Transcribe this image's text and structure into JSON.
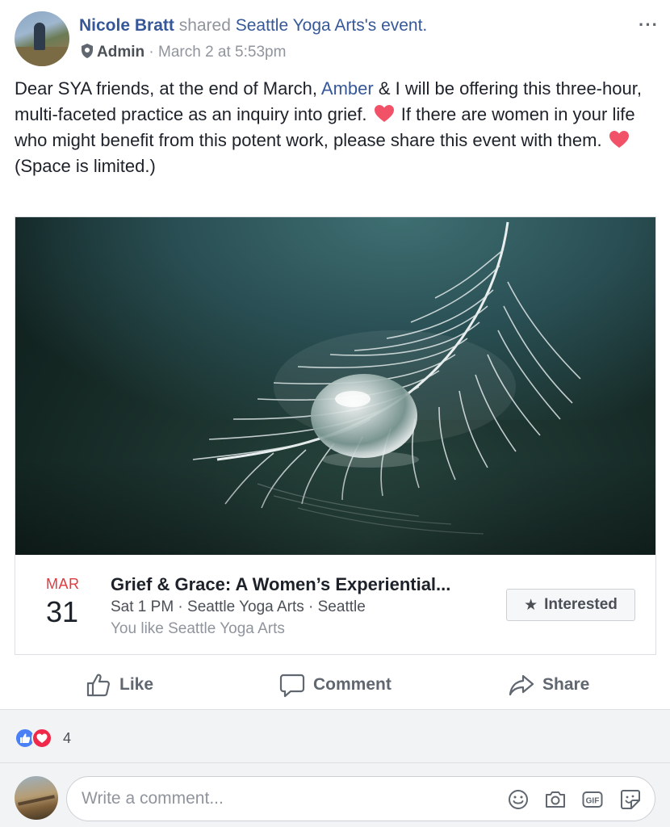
{
  "post": {
    "author": "Nicole Bratt",
    "shared_text": " shared ",
    "page_name": "Seattle Yoga Arts",
    "event_suffix": "'s event.",
    "role": "Admin",
    "separator": " · ",
    "timestamp": "March 2 at 5:53pm",
    "more_icon": "more-options-icon",
    "body": {
      "line1_a": "Dear SYA friends, at the end of March, ",
      "mention": "Amber",
      "line1_b": " & I will be offering this three-hour, multi-faceted practice as an inquiry into grief. ",
      "line2": " If there are women in your life who might benefit from this potent work, please share this event with them. ",
      "line3": "(Space is limited.)"
    }
  },
  "event": {
    "image_alt": "white feather with water droplet",
    "month": "MAR",
    "day": "31",
    "title": "Grief & Grace: A Women’s Experiential...",
    "details": "Sat 1 PM · Seattle Yoga Arts · Seattle",
    "social": "You like Seattle Yoga Arts",
    "interested_label": "Interested",
    "star_icon": "★"
  },
  "actions": {
    "like": "Like",
    "comment": "Comment",
    "share": "Share"
  },
  "reactions": {
    "count": "4",
    "types": [
      "like",
      "love"
    ],
    "colors": {
      "like": "#4a80f5",
      "love": "#f0284a"
    }
  },
  "comment_box": {
    "placeholder": "Write a comment..."
  },
  "colors": {
    "link": "#365899",
    "muted": "#90949c",
    "date_red": "#e0393e",
    "background": "#f2f3f5"
  }
}
